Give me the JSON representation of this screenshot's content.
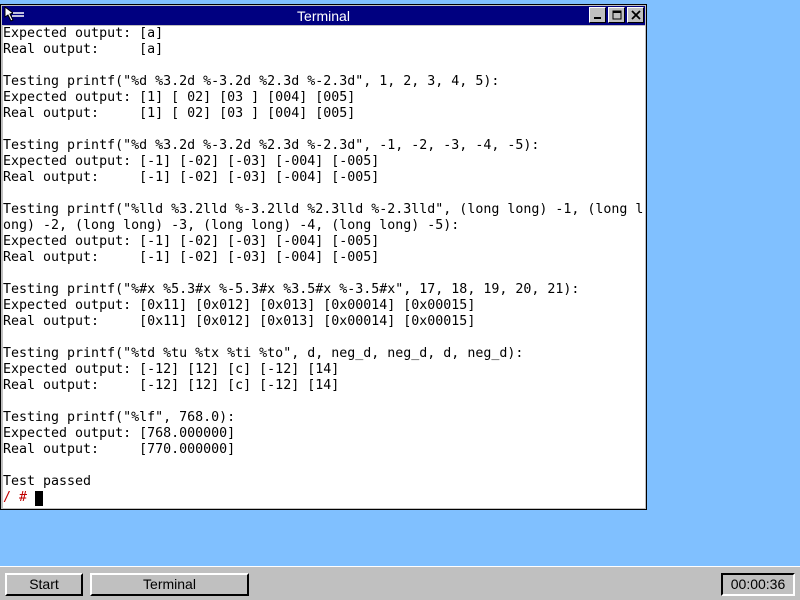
{
  "window": {
    "title": "Terminal",
    "controls": {
      "minimize": "_",
      "maximize": "□",
      "close": "✕"
    }
  },
  "terminal": {
    "lines": [
      "Expected output: [a]",
      "Real output:     [a]",
      "",
      "Testing printf(\"%d %3.2d %-3.2d %2.3d %-2.3d\", 1, 2, 3, 4, 5):",
      "Expected output: [1] [ 02] [03 ] [004] [005]",
      "Real output:     [1] [ 02] [03 ] [004] [005]",
      "",
      "Testing printf(\"%d %3.2d %-3.2d %2.3d %-2.3d\", -1, -2, -3, -4, -5):",
      "Expected output: [-1] [-02] [-03] [-004] [-005]",
      "Real output:     [-1] [-02] [-03] [-004] [-005]",
      "",
      "Testing printf(\"%lld %3.2lld %-3.2lld %2.3lld %-2.3lld\", (long long) -1, (long l",
      "ong) -2, (long long) -3, (long long) -4, (long long) -5):",
      "Expected output: [-1] [-02] [-03] [-004] [-005]",
      "Real output:     [-1] [-02] [-03] [-004] [-005]",
      "",
      "Testing printf(\"%#x %5.3#x %-5.3#x %3.5#x %-3.5#x\", 17, 18, 19, 20, 21):",
      "Expected output: [0x11] [0x012] [0x013] [0x00014] [0x00015]",
      "Real output:     [0x11] [0x012] [0x013] [0x00014] [0x00015]",
      "",
      "Testing printf(\"%td %tu %tx %ti %to\", d, neg_d, neg_d, d, neg_d):",
      "Expected output: [-12] [12] [c] [-12] [14]",
      "Real output:     [-12] [12] [c] [-12] [14]",
      "",
      "Testing printf(\"%lf\", 768.0):",
      "Expected output: [768.000000]",
      "Real output:     [770.000000]",
      "",
      "Test passed"
    ],
    "prompt": "/ # "
  },
  "taskbar": {
    "start_label": "Start",
    "task_label": "Terminal",
    "clock": "00:00:36"
  },
  "colors": {
    "desktop": "#80c0ff",
    "titlebar": "#000080",
    "prompt": "#c00000"
  }
}
